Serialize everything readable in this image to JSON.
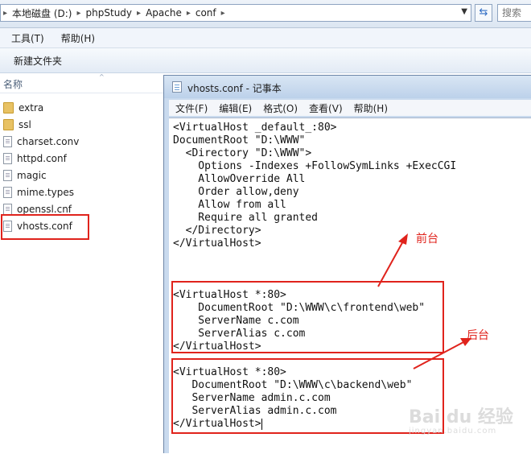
{
  "explorer": {
    "breadcrumb": [
      "本地磁盘 (D:)",
      "phpStudy",
      "Apache",
      "conf"
    ],
    "search_placeholder": "搜索",
    "menu": [
      "工具(T)",
      "帮助(H)"
    ],
    "toolbar_new_folder": "新建文件夹",
    "column_name": "名称",
    "files": [
      {
        "name": "extra",
        "type": "folder"
      },
      {
        "name": "ssl",
        "type": "folder"
      },
      {
        "name": "charset.conv",
        "type": "file"
      },
      {
        "name": "httpd.conf",
        "type": "file"
      },
      {
        "name": "magic",
        "type": "file"
      },
      {
        "name": "mime.types",
        "type": "file"
      },
      {
        "name": "openssl.cnf",
        "type": "file"
      },
      {
        "name": "vhosts.conf",
        "type": "file"
      }
    ]
  },
  "notepad": {
    "title": "vhosts.conf - 记事本",
    "menu": [
      "文件(F)",
      "编辑(E)",
      "格式(O)",
      "查看(V)",
      "帮助(H)"
    ],
    "lines": [
      "<VirtualHost _default_:80>",
      "DocumentRoot \"D:\\WWW\"",
      "  <Directory \"D:\\WWW\">",
      "    Options -Indexes +FollowSymLinks +ExecCGI",
      "    AllowOverride All",
      "    Order allow,deny",
      "    Allow from all",
      "    Require all granted",
      "  </Directory>",
      "</VirtualHost>",
      "",
      "",
      "",
      "<VirtualHost *:80>",
      "    DocumentRoot \"D:\\WWW\\c\\frontend\\web\"",
      "    ServerName c.com",
      "    ServerAlias c.com",
      "</VirtualHost>",
      "",
      "<VirtualHost *:80>",
      "   DocumentRoot \"D:\\WWW\\c\\backend\\web\"",
      "   ServerName admin.c.com",
      "   ServerAlias admin.c.com",
      "</VirtualHost>"
    ]
  },
  "annotations": {
    "frontend": "前台",
    "backend": "后台",
    "color": "#e0231c"
  },
  "watermark": {
    "main": "Bai du 经验",
    "sub": "jingyan.baidu.com"
  }
}
